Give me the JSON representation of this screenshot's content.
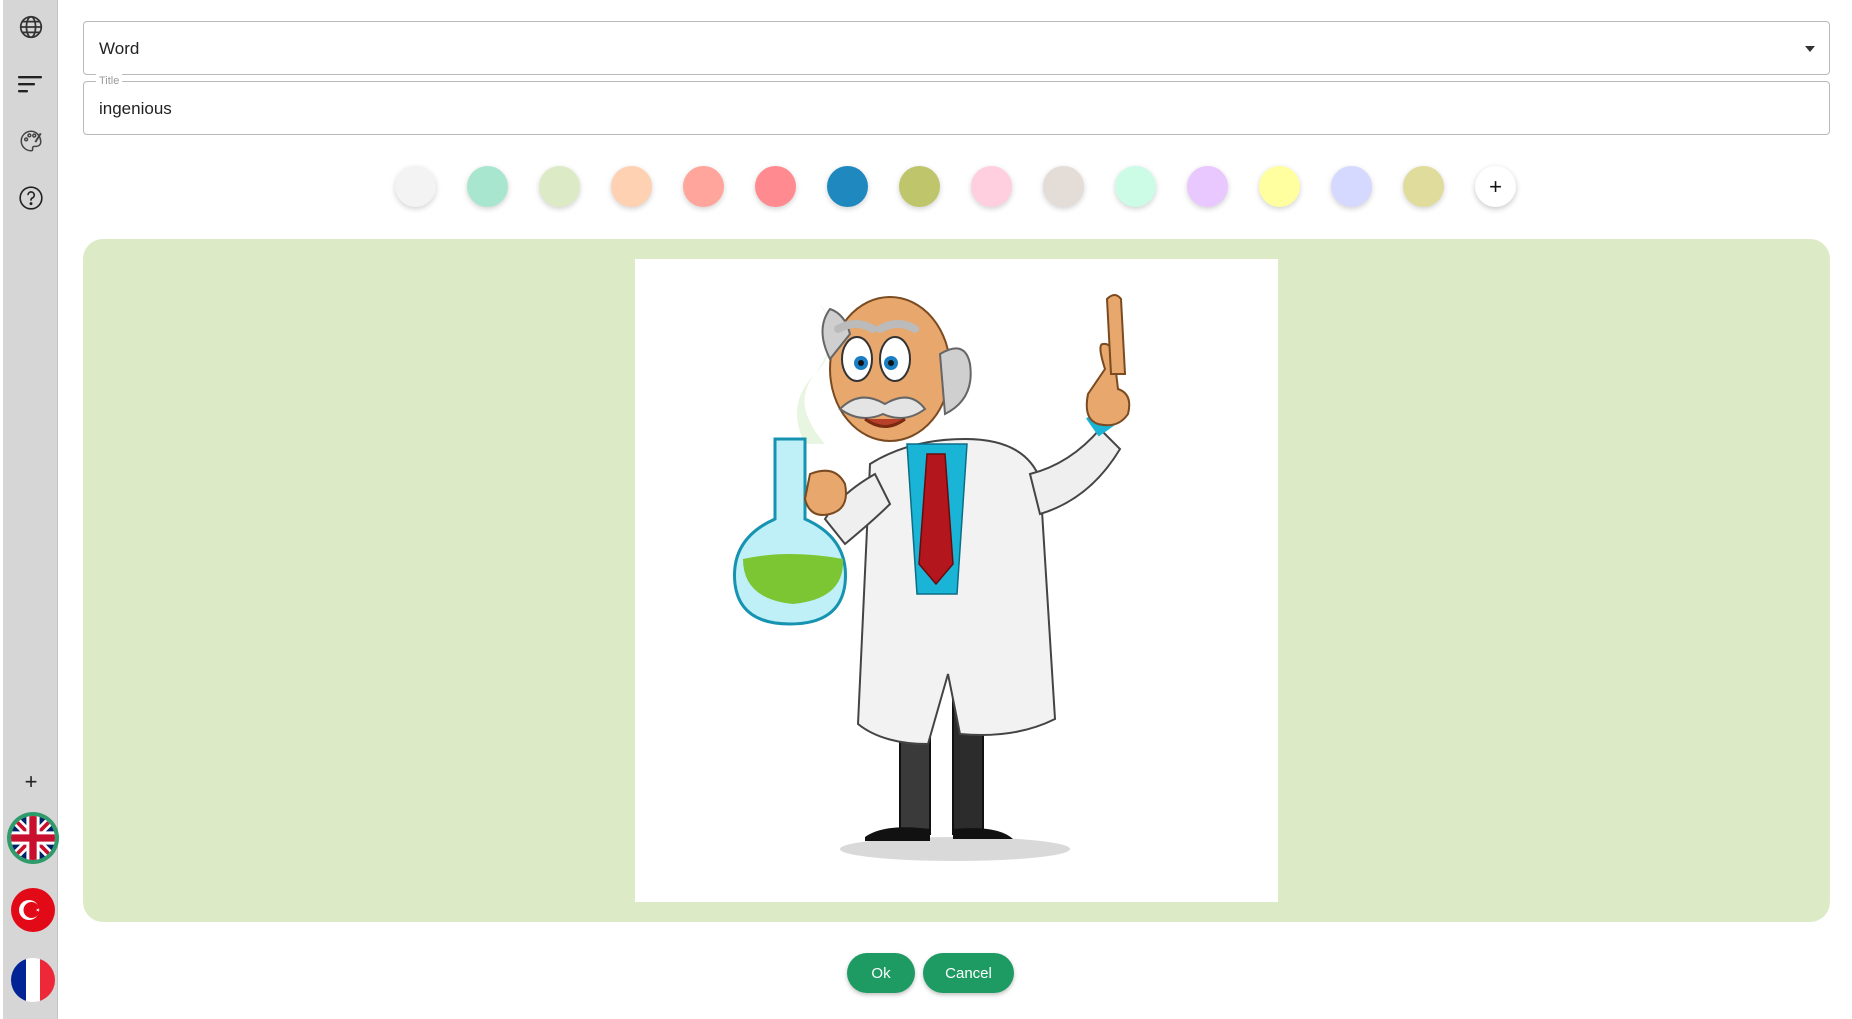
{
  "sidebar": {
    "icons": [
      "globe-icon",
      "sort-icon",
      "palette-icon",
      "help-icon"
    ],
    "add_symbol": "+",
    "languages": [
      "united-kingdom",
      "turkey",
      "france"
    ]
  },
  "type_select": {
    "value": "Word"
  },
  "title_field": {
    "legend": "Title",
    "value": "ingenious"
  },
  "colors": {
    "swatches": [
      "#f3f3f3",
      "#a9e6cf",
      "#dcebc5",
      "#ffd1b3",
      "#ffa59b",
      "#ff8a8f",
      "#1e88bf",
      "#bec56b",
      "#ffcfe0",
      "#e3dcd7",
      "#ccfbe6",
      "#e8c8ff",
      "#ffff9f",
      "#d5d8ff",
      "#e0dc9c"
    ],
    "add_label": "+",
    "selected_background": "#dcebc5",
    "accent": "#1e9b63"
  },
  "card": {
    "image_alt": "scientist-illustration"
  },
  "actions": {
    "ok_label": "Ok",
    "cancel_label": "Cancel"
  }
}
